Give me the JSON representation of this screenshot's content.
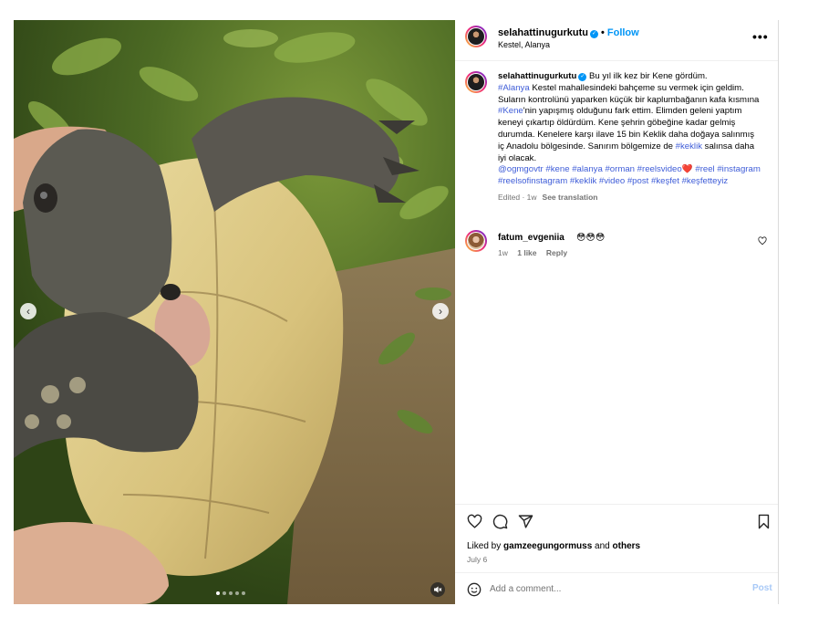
{
  "media": {
    "slide_count": 5,
    "active_slide": 1,
    "prev_glyph": "‹",
    "next_glyph": "›",
    "mute_icon": "speaker-muted-icon"
  },
  "header": {
    "username": "selahattinugurkutu",
    "verified": true,
    "separator": "•",
    "follow_label": "Follow",
    "location": "Kestel, Alanya",
    "more_glyph": "•••"
  },
  "caption": {
    "username": "selahattinugurkutu",
    "text_1": " Bu yıl ilk kez bir Kene gördüm.",
    "tag_alanya": "#Alanya",
    "text_2": " Kestel mahallesindeki bahçeme su vermek için geldim. Suların kontrolünü yaparken küçük bir kaplumbağanın kafa kısmına ",
    "tag_kene": "#Kene",
    "text_3": "'nin yapışmış olduğunu fark ettim. Elimden geleni yaptım keneyi çıkartıp öldürdüm. Kene şehrin göbeğine kadar gelmiş durumda. Kenelere karşı ilave 15 bin Keklik daha doğaya salınmış iç Anadolu bölgesinde. Sanırım bölgemize de ",
    "tag_keklik": "#keklik",
    "text_4": " salınsa daha iyi olacak.",
    "tags_line": "@ogmgovtr #kene #alanya #orman #reelsvideo",
    "heart": "❤️",
    "tags_line_2": " #reel #instagram #reelsofinstagram #keklik #video #post #keşfet #keşfetteyiz",
    "edited": "Edited · 1w",
    "see_translation": "See translation"
  },
  "comments": [
    {
      "username": "fatum_evgeniia",
      "text": "😳😳😳",
      "time": "1w",
      "likes": "1 like",
      "reply_label": "Reply"
    }
  ],
  "actions": {
    "liked_by_prefix": "Liked by ",
    "liked_by_user": "gamzeegungormuss",
    "liked_by_and": " and ",
    "liked_by_others": "others",
    "date": "July 6"
  },
  "add_comment": {
    "placeholder": "Add a comment...",
    "post_label": "Post"
  }
}
